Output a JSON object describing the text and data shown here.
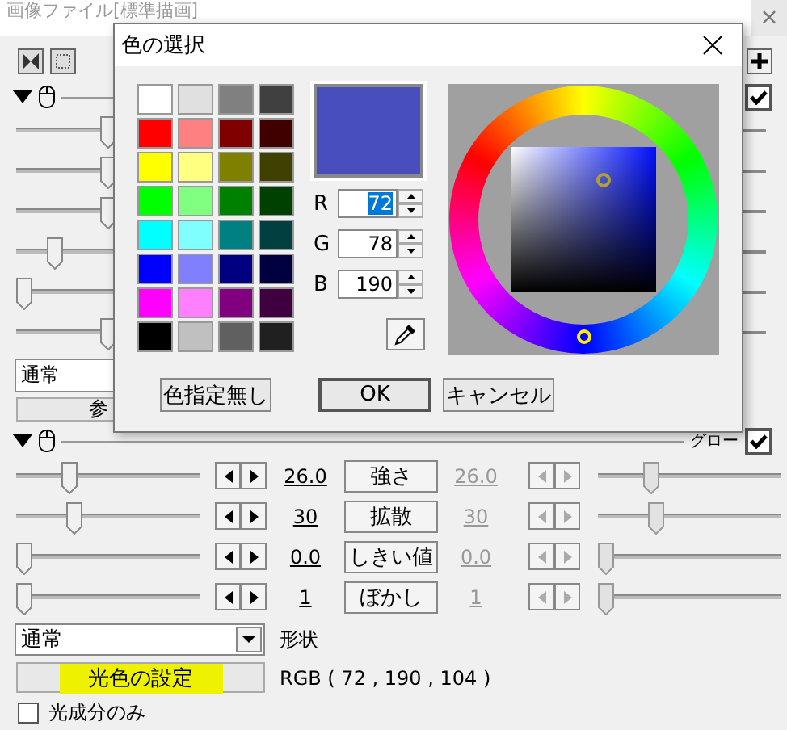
{
  "window": {
    "title": "画像ファイル[標準描画]",
    "close": "×"
  },
  "upper": {
    "expanded": true,
    "checked": true,
    "sliders": [
      {
        "level": 0.5
      },
      {
        "level": 0.5
      },
      {
        "level": 0.5
      },
      {
        "level": 0.18
      },
      {
        "level": 0.0
      },
      {
        "level": 0.5
      }
    ],
    "blend": "通常",
    "button": "参"
  },
  "dialog": {
    "title": "色の選択",
    "swatches": [
      {
        "color": "#ffffff"
      },
      {
        "color": "#e0e0e0"
      },
      {
        "color": "#808080"
      },
      {
        "color": "#404040"
      },
      {
        "color": "#ff0000"
      },
      {
        "color": "#ff8080"
      },
      {
        "color": "#800000"
      },
      {
        "color": "#400000"
      },
      {
        "color": "#ffff00"
      },
      {
        "color": "#ffff80"
      },
      {
        "color": "#808000"
      },
      {
        "color": "#404000"
      },
      {
        "color": "#00ff00"
      },
      {
        "color": "#80ff80"
      },
      {
        "color": "#008000"
      },
      {
        "color": "#004000"
      },
      {
        "color": "#00ffff"
      },
      {
        "color": "#80ffff"
      },
      {
        "color": "#008080"
      },
      {
        "color": "#004040"
      },
      {
        "color": "#0000ff"
      },
      {
        "color": "#8080ff"
      },
      {
        "color": "#000080"
      },
      {
        "color": "#000040"
      },
      {
        "color": "#ff00ff"
      },
      {
        "color": "#ff80ff"
      },
      {
        "color": "#800080"
      },
      {
        "color": "#400040"
      },
      {
        "color": "#000000"
      },
      {
        "color": "#c0c0c0"
      },
      {
        "color": "#606060"
      },
      {
        "color": "#202020"
      }
    ],
    "fields": [
      {
        "label": "R",
        "value": "72",
        "selected": true
      },
      {
        "label": "G",
        "value": "78",
        "selected": false
      },
      {
        "label": "B",
        "value": "190",
        "selected": false
      }
    ],
    "buttons": [
      "色指定無し",
      "OK",
      "キャンセル"
    ]
  },
  "glow": {
    "label": "グロー",
    "checked": true,
    "expanded": true,
    "rows": [
      {
        "level": 0.27,
        "value": "26.0",
        "label": "強さ",
        "end": {
          "value": "26.0",
          "level": 0.27,
          "disabled": true
        }
      },
      {
        "level": 0.3,
        "value": "30",
        "label": "拡散",
        "end": {
          "value": "30",
          "level": 0.3,
          "disabled": true
        }
      },
      {
        "level": 0.0,
        "value": "0.0",
        "label": "しきい値",
        "end": {
          "value": "0.0",
          "level": 0.0,
          "disabled": true
        }
      },
      {
        "level": 0.0,
        "value": "1",
        "label": "ぼかし",
        "end": {
          "value": "1",
          "level": 0.0,
          "disabled": true
        }
      }
    ],
    "shape": {
      "value": "通常",
      "label": "形状"
    },
    "color_button": {
      "label": "光色の設定",
      "highlighted": true
    },
    "rgb": "RGB ( 72 , 190 , 104 )",
    "light_only": {
      "label": "光成分のみ",
      "checked": false
    }
  }
}
